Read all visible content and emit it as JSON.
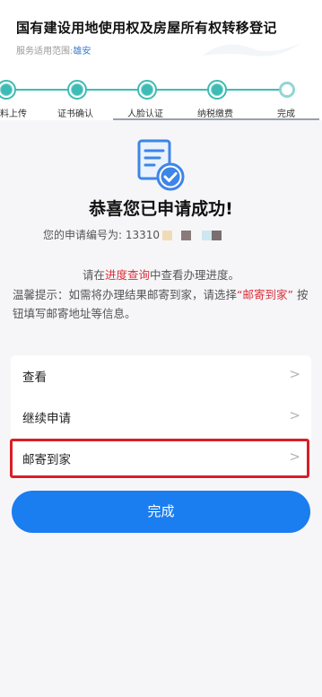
{
  "header": {
    "title": "国有建设用地使用权及房屋所有权转移登记",
    "service_scope_label": "服务适用范围:",
    "service_scope_region": "雄安"
  },
  "steps": [
    {
      "label": "料上传",
      "status": "done"
    },
    {
      "label": "证书确认",
      "status": "done"
    },
    {
      "label": "人脸认证",
      "status": "done"
    },
    {
      "label": "纳税缴费",
      "status": "done"
    },
    {
      "label": "完成",
      "status": "current"
    }
  ],
  "result": {
    "icon": "document-check-icon",
    "title": "恭喜您已申请成功!",
    "application_no_label": "您的申请编号为:",
    "application_no_value": "13310"
  },
  "tips": {
    "line1_prefix": "请在",
    "line1_link": "进度查询",
    "line1_suffix": "中查看办理进度。",
    "line2_prefix": "温馨提示：如需将办理结果邮寄到家，请选择",
    "line2_highlight": "“邮寄到家”",
    "line2_suffix": "按钮填写邮寄地址等信息。"
  },
  "menu": {
    "items": [
      {
        "label": "查看"
      },
      {
        "label": "继续申请"
      },
      {
        "label": "邮寄到家"
      }
    ],
    "chevron": ">"
  },
  "done_button": {
    "label": "完成"
  },
  "colors": {
    "primary": "#1a7df0",
    "step_teal": "#3cbcb4",
    "highlight_red": "#d81f26",
    "link_red": "#d9303b"
  }
}
